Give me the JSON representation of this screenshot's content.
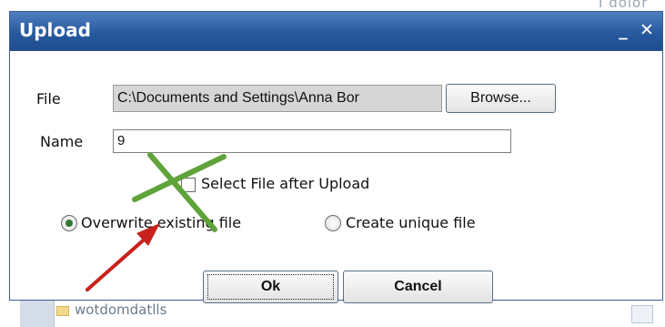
{
  "background": {
    "top_text": "I dolor",
    "bottom_text": "wotdomdatlls"
  },
  "dialog": {
    "title": "Upload",
    "titlebar_buttons": {
      "minimize": "_",
      "close": "✕"
    },
    "file_label": "File",
    "file_value": "C:\\Documents and Settings\\Anna Bor",
    "browse_label": "Browse...",
    "name_label": "Name",
    "name_value": "9",
    "select_after_upload_label": "Select File after Upload",
    "select_after_upload_checked": false,
    "overwrite_label": "Overwrite existing file",
    "overwrite_selected": true,
    "unique_label": "Create unique file",
    "unique_selected": false,
    "ok_label": "Ok",
    "cancel_label": "Cancel"
  },
  "annotations": {
    "cross_color": "#5fa33a",
    "arrow_color": "#c8211c"
  },
  "icons": [
    "minimize-icon",
    "close-icon",
    "folder-icon"
  ]
}
